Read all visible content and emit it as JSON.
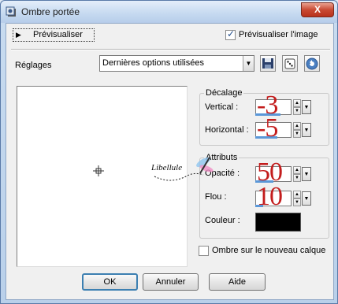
{
  "window": {
    "title": "Ombre portée",
    "close_label": "X"
  },
  "preview": {
    "toggle_label": "Prévisualiser",
    "image_checkbox_label": "Prévisualiser l'image",
    "image_checked": true
  },
  "reglages": {
    "label": "Réglages",
    "selected": "Dernières options utilisées"
  },
  "decalage": {
    "title": "Décalage",
    "vertical_label": "Vertical :",
    "vertical_value": "-3",
    "horizontal_label": "Horizontal :",
    "horizontal_value": "-5"
  },
  "attributs": {
    "title": "Attributs",
    "opacite_label": "Opacité :",
    "opacite_value": "50",
    "flou_label": "Flou :",
    "flou_value": "10",
    "couleur_label": "Couleur :",
    "couleur_value": "#000000"
  },
  "ombre_calque": {
    "label": "Ombre sur le nouveau calque",
    "checked": false
  },
  "buttons": {
    "ok": "OK",
    "cancel": "Annuler",
    "help": "Aide"
  },
  "watermark": {
    "text": "Libellule"
  }
}
